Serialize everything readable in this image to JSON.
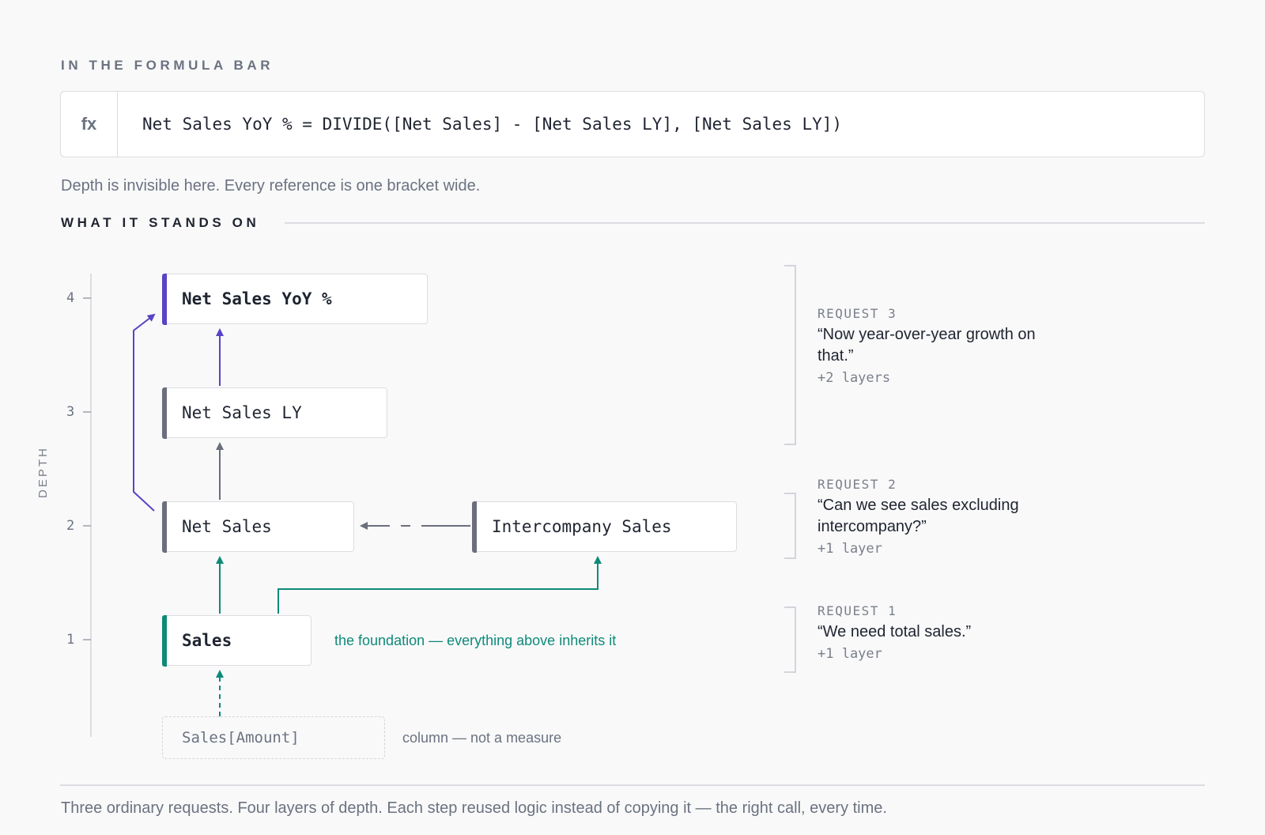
{
  "formula_section": {
    "heading": "IN THE FORMULA BAR",
    "fx_label": "fx",
    "formula": "Net Sales YoY % = DIVIDE([Net Sales] - [Net Sales LY], [Net Sales LY])",
    "note": "Depth is invisible here. Every reference is one bracket wide."
  },
  "diagram": {
    "heading": "WHAT IT STANDS ON",
    "axis_title": "DEPTH",
    "ticks": [
      "4",
      "3",
      "2",
      "1"
    ],
    "nodes": {
      "yoy": "Net Sales YoY %",
      "ly": "Net Sales LY",
      "net_sales": "Net Sales",
      "intercompany": "Intercompany Sales",
      "sales": "Sales",
      "column": "Sales[Amount]"
    },
    "captions": {
      "foundation": "the foundation — everything above inherits it",
      "column": "column — not a measure"
    },
    "colors": {
      "purple": "#5a43c4",
      "gray": "#6b6f7c",
      "teal": "#0e8a78"
    }
  },
  "requests": [
    {
      "label": "REQUEST 3",
      "quote": "“Now year-over-year growth on that.”",
      "layers": "+2 layers"
    },
    {
      "label": "REQUEST 2",
      "quote": "“Can we see sales excluding intercompany?”",
      "layers": "+1 layer"
    },
    {
      "label": "REQUEST 1",
      "quote": "“We need total sales.”",
      "layers": "+1 layer"
    }
  ],
  "footer": "Three ordinary requests. Four layers of depth. Each step reused logic instead of copying it — the right call, every time."
}
